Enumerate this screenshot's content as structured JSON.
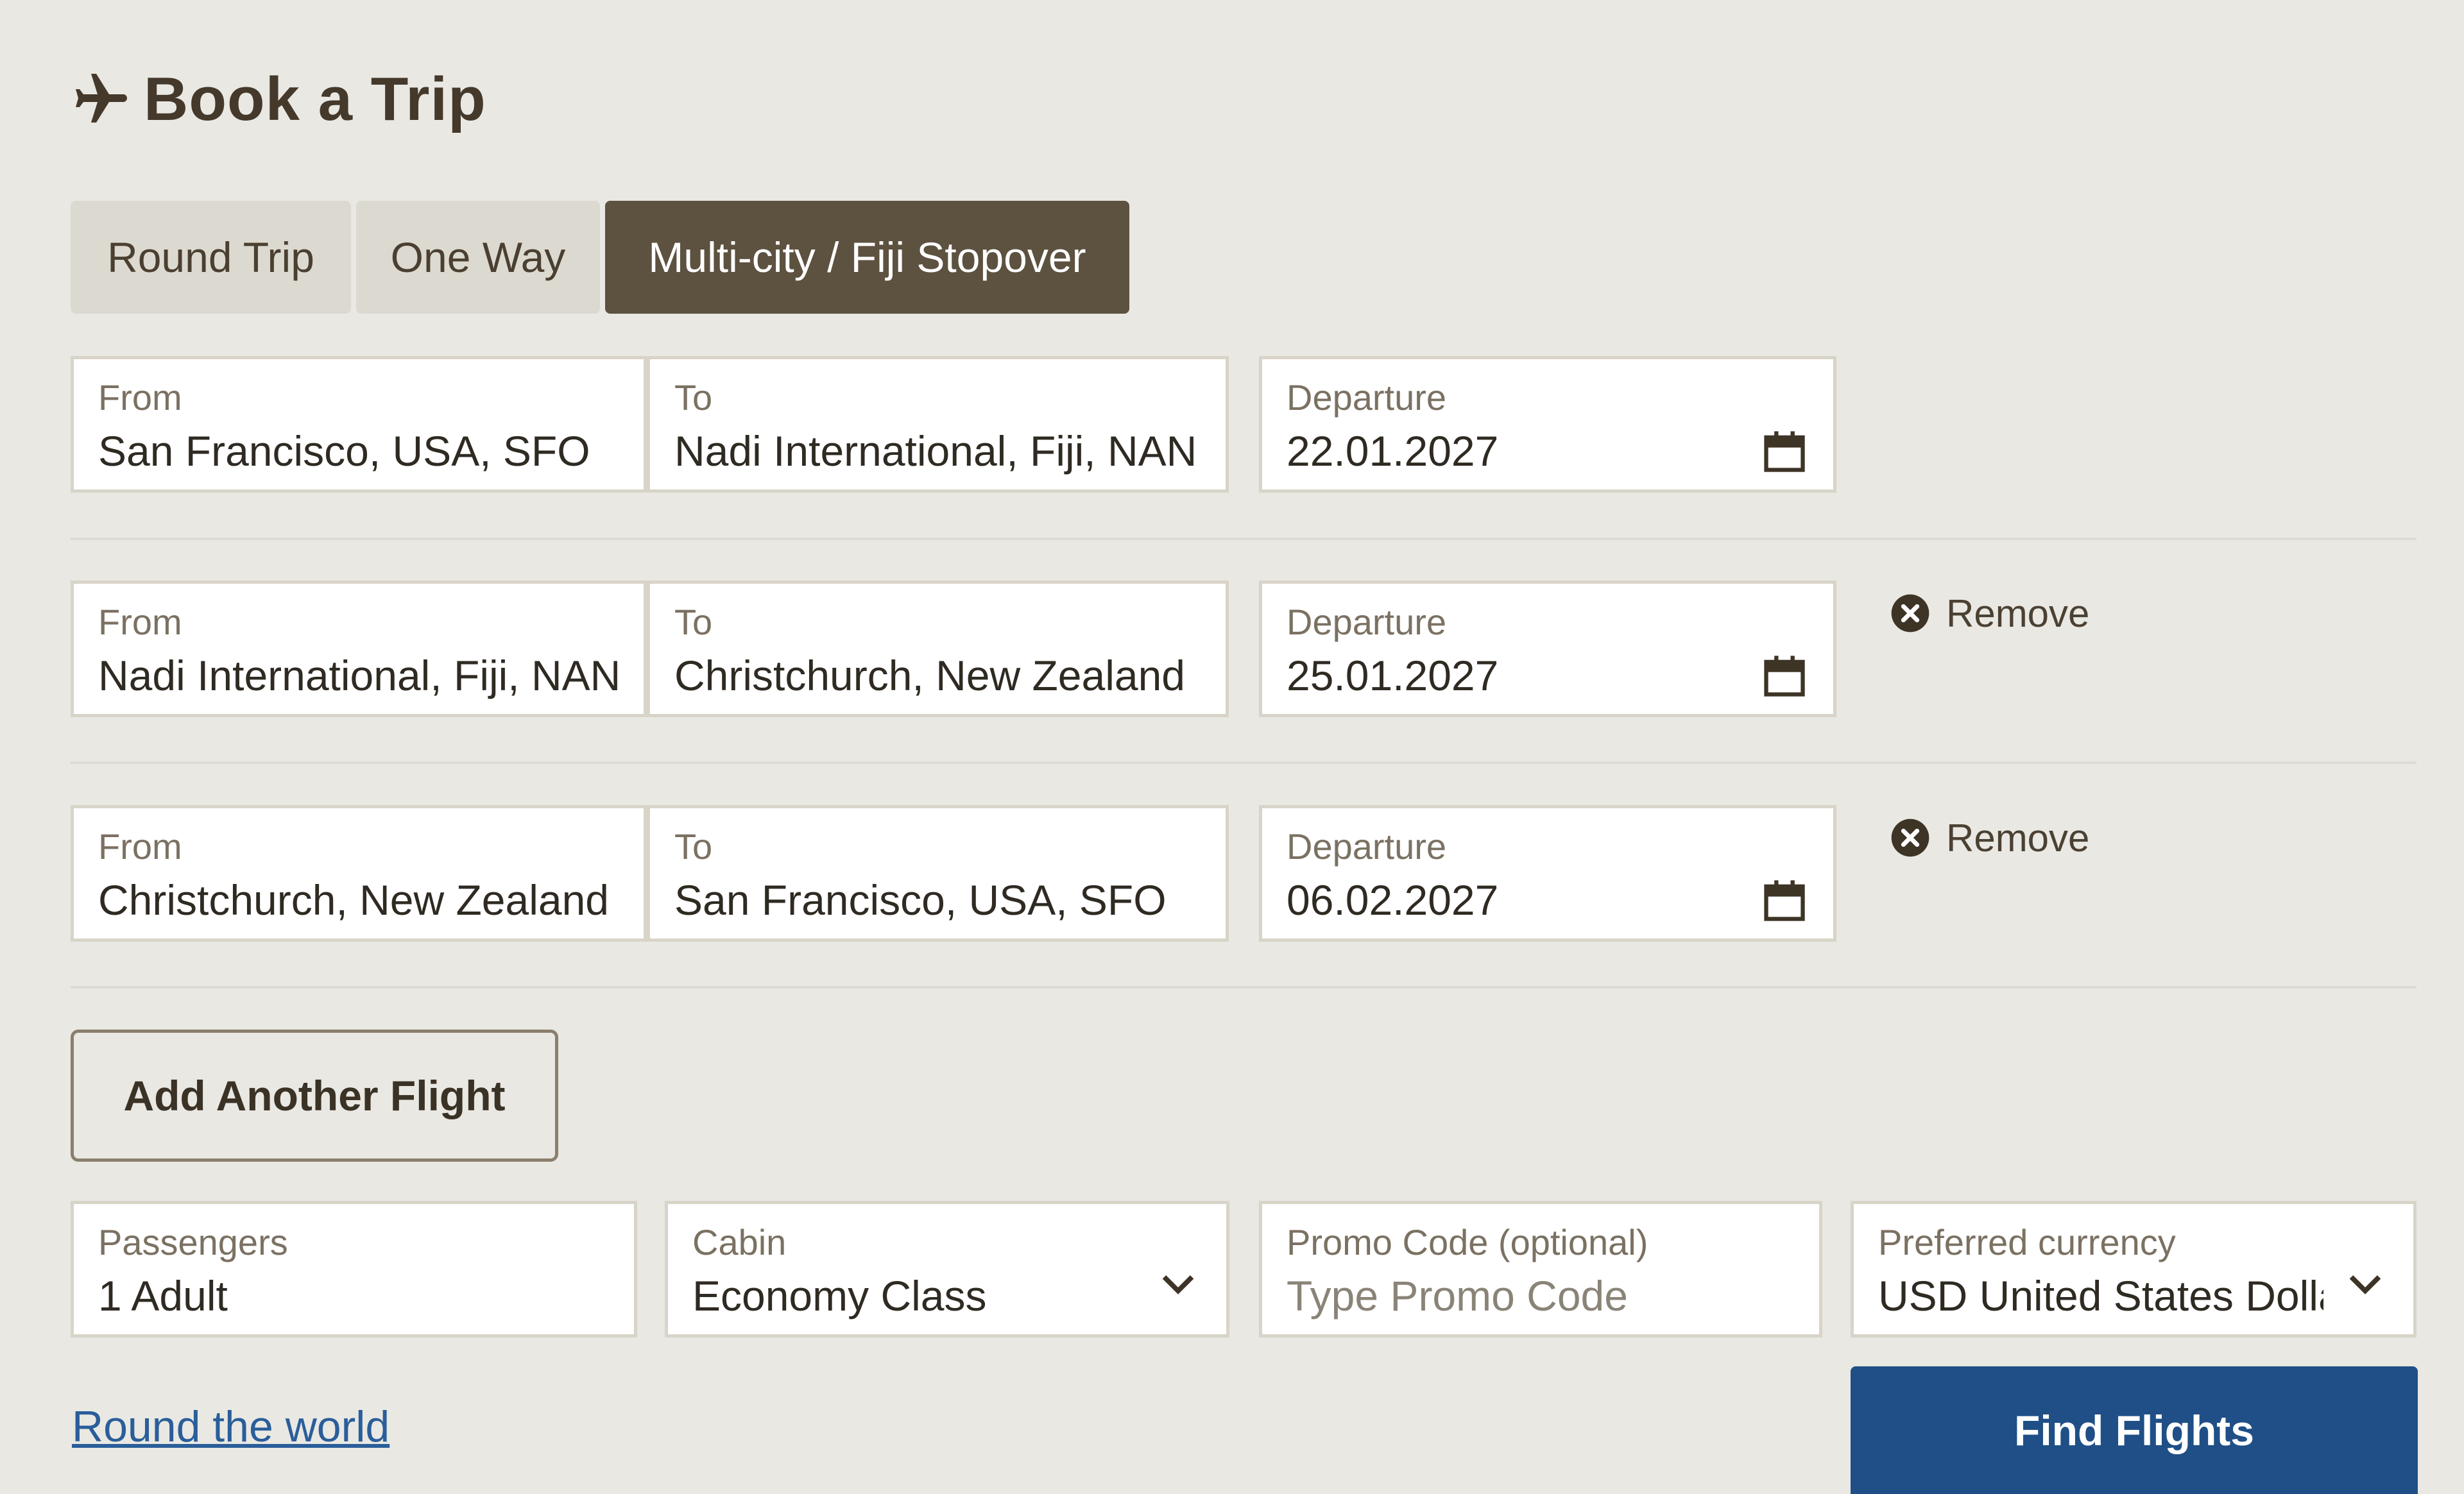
{
  "header": {
    "title": "Book a Trip",
    "icon": "plane-icon"
  },
  "tabs": [
    {
      "label": "Round Trip",
      "active": false
    },
    {
      "label": "One Way",
      "active": false
    },
    {
      "label": "Multi-city / Fiji Stopover",
      "active": true
    }
  ],
  "flights": [
    {
      "from_label": "From",
      "from_value": "San Francisco, USA, SFO",
      "to_label": "To",
      "to_value": "Nadi International, Fiji, NAN",
      "departure_label": "Departure",
      "departure_value": "22.01.2027",
      "removable": false
    },
    {
      "from_label": "From",
      "from_value": "Nadi International, Fiji, NAN",
      "to_label": "To",
      "to_value": "Christchurch, New Zealand",
      "departure_label": "Departure",
      "departure_value": "25.01.2027",
      "removable": true,
      "remove_label": "Remove"
    },
    {
      "from_label": "From",
      "from_value": "Christchurch, New Zealand",
      "to_label": "To",
      "to_value": "San Francisco, USA, SFO",
      "departure_label": "Departure",
      "departure_value": "06.02.2027",
      "removable": true,
      "remove_label": "Remove"
    }
  ],
  "add_flight_label": "Add Another Flight",
  "options": {
    "passengers_label": "Passengers",
    "passengers_value": "1 Adult",
    "cabin_label": "Cabin",
    "cabin_value": "Economy Class",
    "promo_label": "Promo Code (optional)",
    "promo_placeholder": "Type Promo Code",
    "currency_label": "Preferred currency",
    "currency_value": "USD United States Dollar"
  },
  "round_the_world_link": "Round the world",
  "find_flights_label": "Find Flights",
  "colors": {
    "background": "#e9e8e3",
    "active_tab": "#5d5140",
    "primary_button": "#1f4f86",
    "link": "#2a5e9a"
  }
}
